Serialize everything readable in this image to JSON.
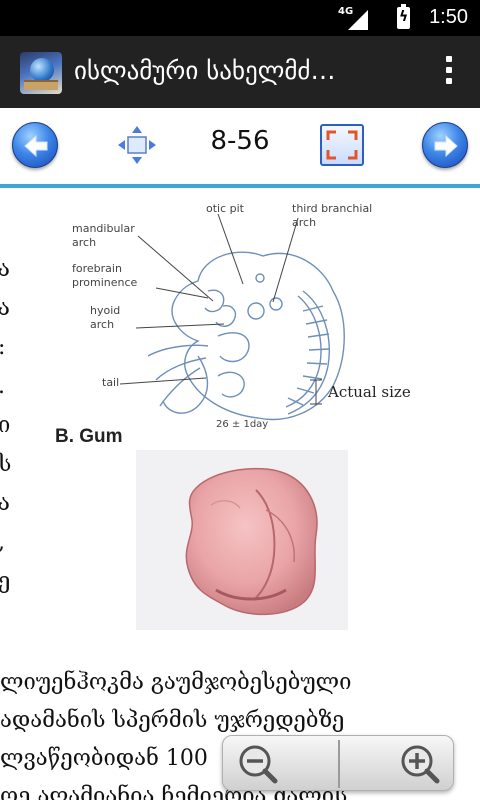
{
  "status_bar": {
    "network": "4G",
    "time": "1:50"
  },
  "action_bar": {
    "title": "ისლამური სახელმძ…",
    "icon": "book-globe-app-icon",
    "menu_icon": "overflow-menu-icon"
  },
  "toolbar": {
    "back_icon": "arrow-left-icon",
    "move_icon": "move-arrows-icon",
    "page_indicator": "8-56",
    "fit_icon": "fullscreen-icon",
    "forward_icon": "arrow-right-icon",
    "accent_color": "#3ca7d6"
  },
  "page": {
    "left_column_chars": [
      "ა",
      "ა",
      ":",
      ".",
      "ი",
      "ს",
      "ა",
      ",",
      "ე"
    ],
    "figure_labels": {
      "otic_pit": "otic pit",
      "third_branchial": "third branchial",
      "arch_right": "arch",
      "mandibular": "mandibular",
      "arch_left": "arch",
      "forebrain": "forebrain",
      "prominence": "prominence",
      "hyoid": "hyoid",
      "arch_hyoid": "arch",
      "tail": "tail",
      "actual_size": "Actual size",
      "age": "26 ± 1day"
    },
    "gum_title": "B. Gum",
    "body_lines": [
      "ლიუენჰოკმა   გაუმჯობესებული",
      "ადამანის სპერმის უჯრედებზე",
      "ლვაწეობიდან 100",
      "ოე აღამიანია ჩემიერია ძალის"
    ]
  },
  "zoom": {
    "zoom_out_icon": "zoom-out-icon",
    "zoom_in_icon": "zoom-in-icon"
  }
}
